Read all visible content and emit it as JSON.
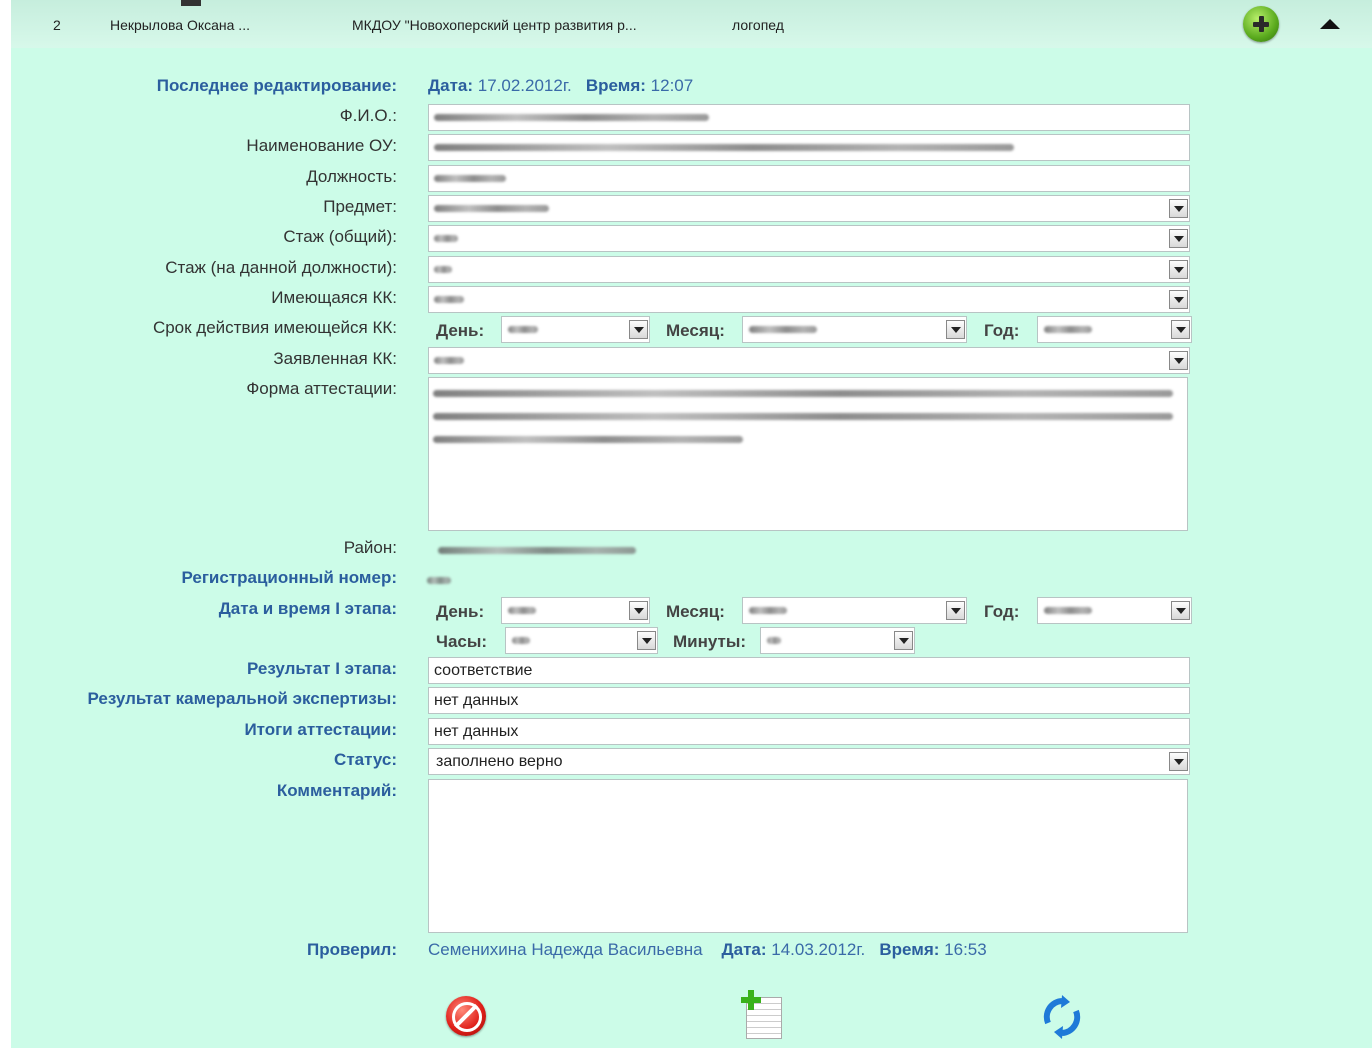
{
  "header": {
    "index": "2",
    "name": "Некрылова Оксана ...",
    "org": "МКДОУ \"Новохоперский центр развития р...",
    "position": "логопед"
  },
  "form": {
    "last_edit_label": "Последнее редактирование:",
    "date_label": "Дата:",
    "last_edit_date": "17.02.2012г.",
    "time_label": "Время:",
    "last_edit_time": "12:07",
    "fio_label": "Ф.И.О.:",
    "org_label": "Наименование ОУ:",
    "post_label": "Должность:",
    "subject_label": "Предмет:",
    "exp_total_label": "Стаж (общий):",
    "exp_post_label": "Стаж (на данной должности):",
    "kk_label": "Имеющаяся КК:",
    "kk_expiry_label": "Срок действия имеющейся КК:",
    "day_label": "День:",
    "month_label": "Месяц:",
    "year_label": "Год:",
    "declared_kk_label": "Заявленная КК:",
    "attestation_form_label": "Форма аттестации:",
    "district_label": "Район:",
    "reg_number_label": "Регистрационный номер:",
    "stage1_datetime_label": "Дата и время I этапа:",
    "hours_label": "Часы:",
    "minutes_label": "Минуты:",
    "stage1_result_label": "Результат I этапа:",
    "stage1_result_value": "соответствие",
    "expertise_result_label": "Результат камеральной экспертизы:",
    "expertise_result_value": "нет данных",
    "attestation_results_label": "Итоги аттестации:",
    "attestation_results_value": "нет данных",
    "status_label": "Статус:",
    "status_value": "заполнено верно",
    "comment_label": "Комментарий:",
    "checked_by_label": "Проверил:",
    "checked_by_name": "Семенихина Надежда Васильевна",
    "checked_date": "14.03.2012г.",
    "checked_time": "16:53"
  },
  "icons": {
    "add": "plus-circle-icon",
    "collapse": "triangle-up-icon",
    "cancel": "prohibited-icon",
    "new_doc": "add-document-icon",
    "refresh": "refresh-icon"
  },
  "colors": {
    "panel_bg": "#ccfce8",
    "label_blue": "#2b5e9e",
    "value_blue": "#3a6aa8"
  }
}
